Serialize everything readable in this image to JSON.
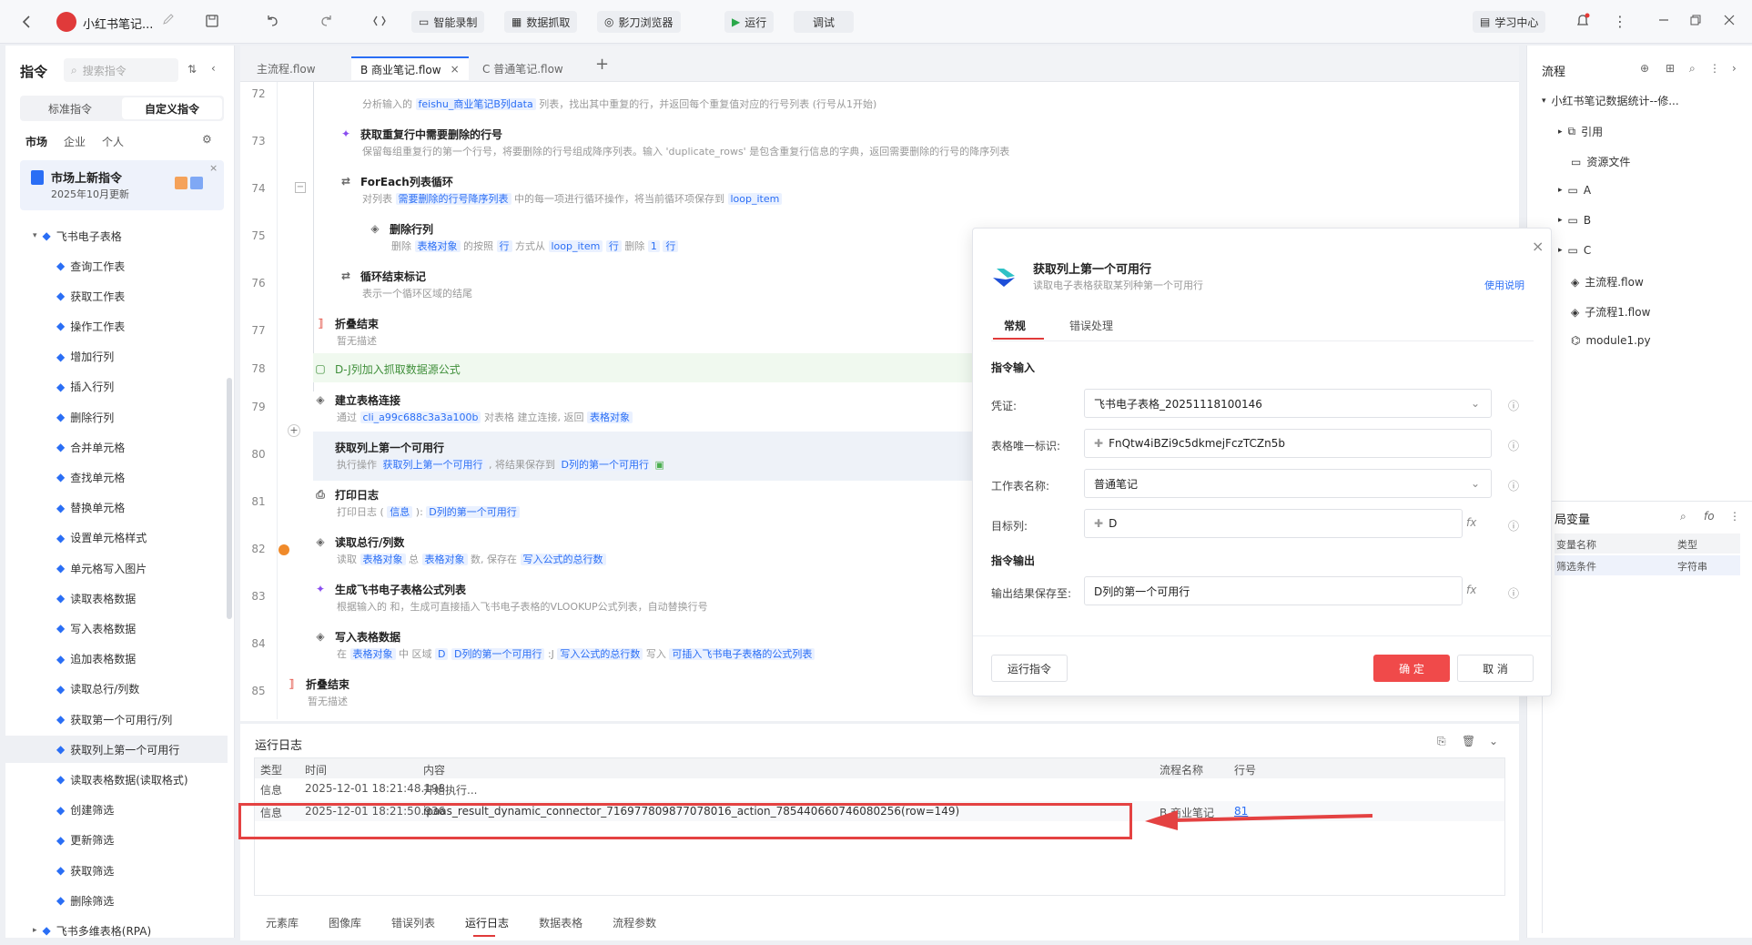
{
  "topbar": {
    "app_name": "小红书笔记...",
    "smart_record": "智能录制",
    "data_capture": "数据抓取",
    "browser": "影刀浏览器",
    "run": "运行",
    "debug": "调试",
    "learn": "学习中心"
  },
  "left": {
    "title": "指令",
    "search_placeholder": "搜索指令",
    "seg": [
      "标准指令",
      "自定义指令"
    ],
    "tabs": [
      "市场",
      "企业",
      "个人"
    ],
    "banner_title": "市场上新指令",
    "banner_sub": "2025年10月更新",
    "group": "飞书电子表格",
    "items": [
      "查询工作表",
      "获取工作表",
      "操作工作表",
      "增加行列",
      "插入行列",
      "删除行列",
      "合并单元格",
      "查找单元格",
      "替换单元格",
      "设置单元格样式",
      "单元格写入图片",
      "读取表格数据",
      "写入表格数据",
      "追加表格数据",
      "读取总行/列数",
      "获取第一个可用行/列",
      "获取列上第一个可用行",
      "读取表格数据(读取格式)",
      "创建筛选",
      "更新筛选",
      "获取筛选",
      "删除筛选"
    ],
    "next_group": "飞书多维表格(RPA)"
  },
  "tabs": [
    "主流程.flow",
    "B 商业笔记.flow",
    "C 普通笔记.flow"
  ],
  "lines": {
    "l72": "72",
    "l73": "73",
    "l74": "74",
    "l75": "75",
    "l76": "76",
    "l77": "77",
    "l78": "78",
    "l79": "79",
    "l80": "80",
    "l81": "81",
    "l82": "82",
    "l83": "83",
    "l84": "84",
    "l85": "85"
  },
  "steps": {
    "s72_desc_a": "分析输入的",
    "s72_chip": "feishu_商业笔记B列data",
    "s72_desc_b": "列表，找出其中重复的行，并返回每个重复值对应的行号列表 (行号从1开始)",
    "s73_title": "获取重复行中需要删除的行号",
    "s73_desc": "保留每组重复行的第一个行号，将要删除的行号组成降序列表。输入 'duplicate_rows' 是包含重复行信息的字典，返回需要删除的行号的降序列表",
    "s74_title": "ForEach列表循环",
    "s74_a": "对列表",
    "s74_chip1": "需要删除的行号降序列表",
    "s74_b": "中的每一项进行循环操作，将当前循环项保存到",
    "s74_chip2": "loop_item",
    "s75_title": "删除行列",
    "s75_a": "删除",
    "s75_chip1": "表格对象",
    "s75_b": "的按照",
    "s75_c": "行",
    "s75_d": "方式从",
    "s75_chip2": "loop_item",
    "s75_e": "行",
    "s75_f": "删除",
    "s75_g": "1",
    "s75_h": "行",
    "s76_title": "循环结束标记",
    "s76_desc": "表示一个循环区域的结尾",
    "s77_title": "折叠结束",
    "s77_desc": "暂无描述",
    "s78_title": "D-J列加入抓取数据源公式",
    "s79_title": "建立表格连接",
    "s79_a": "通过",
    "s79_chip1": "cli_a99c688c3a3a100b",
    "s79_b": "对表格",
    "s79_c": "建立连接, 返回",
    "s79_chip2": "表格对象",
    "s80_title": "获取列上第一个可用行",
    "s80_a": "执行操作",
    "s80_chip1": "获取列上第一个可用行",
    "s80_b": ", 将结果保存到",
    "s80_chip2": "D列的第一个可用行",
    "s81_title": "打印日志",
    "s81_a": "打印日志 (",
    "s81_chip1": "信息",
    "s81_b": "):",
    "s81_chip2": "D列的第一个可用行",
    "s82_title": "读取总行/列数",
    "s82_a": "读取",
    "s82_chip1": "表格对象",
    "s82_b": "总",
    "s82_chip2": "表格对象",
    "s82_c": "数, 保存在",
    "s82_chip3": "写入公式的总行数",
    "s83_title": "生成飞书电子表格公式列表",
    "s83_desc": "根据输入的 和，生成可直接插入飞书电子表格的VLOOKUP公式列表，自动替换行号",
    "s84_title": "写入表格数据",
    "s84_a": "在",
    "s84_chip1": "表格对象",
    "s84_b": "中 区域",
    "s84_c": "D",
    "s84_chip2": "D列的第一个可用行",
    "s84_d": ":J",
    "s84_chip3": "写入公式的总行数",
    "s84_e": "写入",
    "s84_chip4": "可插入飞书电子表格的公式列表",
    "s85_title": "折叠结束",
    "s85_desc": "暂无描述"
  },
  "runlog": {
    "title": "运行日志",
    "headers": [
      "类型",
      "时间",
      "内容",
      "流程名称",
      "行号"
    ],
    "rows": [
      {
        "type": "信息",
        "time": "2025-12-01 18:21:48.198",
        "content": "开始执行...",
        "flow": "",
        "line": ""
      },
      {
        "type": "信息",
        "time": "2025-12-01 18:21:50.936",
        "content": "ipaas_result_dynamic_connector_716977809877078016_action_785440660746080256(row=149)",
        "flow": "B 商业笔记",
        "line": "81"
      }
    ],
    "bottom_tabs": [
      "元素库",
      "图像库",
      "错误列表",
      "运行日志",
      "数据表格",
      "流程参数"
    ]
  },
  "right": {
    "title": "流程",
    "root": "小红书笔记数据统计--修...",
    "items": [
      "引用",
      "资源文件",
      "A",
      "B",
      "C",
      "主流程.flow",
      "子流程1.flow",
      "module1.py"
    ],
    "vars_title": "局变量",
    "var_headers": [
      "变量名称",
      "类型"
    ],
    "var_row": [
      "筛选条件",
      "字符串"
    ]
  },
  "dialog": {
    "title": "获取列上第一个可用行",
    "subtitle": "读取电子表格获取某列种第一个可用行",
    "help": "使用说明",
    "tabs": [
      "常规",
      "错误处理"
    ],
    "input_section": "指令输入",
    "f1_label": "凭证:",
    "f1_value": "飞书电子表格_20251118100146",
    "f2_label": "表格唯一标识:",
    "f2_value": "FnQtw4iBZi9c5dkmejFczTCZn5b",
    "f3_label": "工作表名称:",
    "f3_value": "普通笔记",
    "f4_label": "目标列:",
    "f4_value": "D",
    "output_section": "指令输出",
    "f5_label": "输出结果保存至:",
    "f5_value": "D列的第一个可用行",
    "run_btn": "运行指令",
    "ok_btn": "确 定",
    "cancel_btn": "取 消"
  },
  "colors": {
    "accent": "#2a6ef5",
    "danger": "#f04a4a",
    "highlight": "#e44242"
  }
}
